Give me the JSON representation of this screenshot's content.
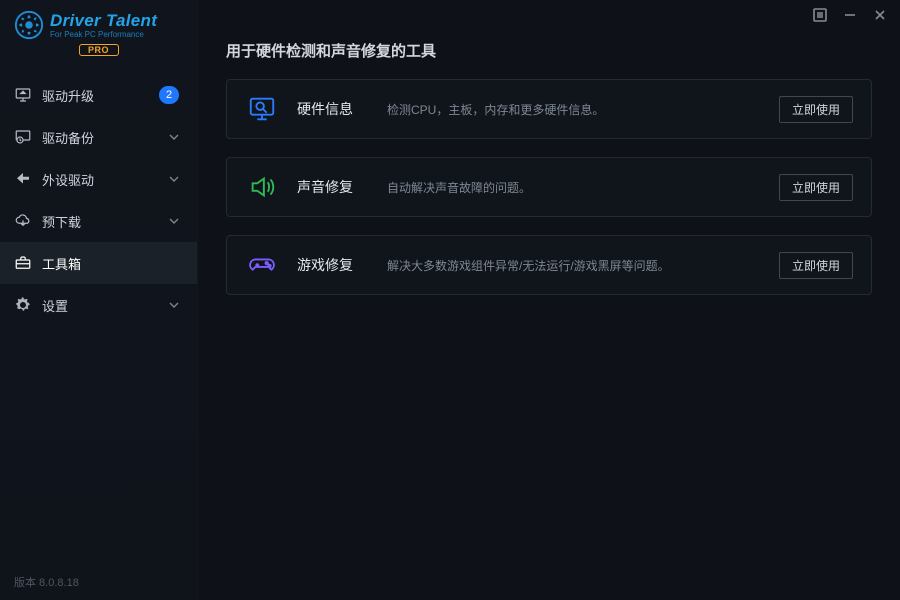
{
  "brand": {
    "title": "Driver Talent",
    "subtitle": "For Peak PC Performance",
    "pro": "PRO"
  },
  "sidebar": {
    "items": [
      {
        "label": "驱动升级",
        "icon": "monitor-upgrade-icon",
        "badge": "2",
        "caret": false
      },
      {
        "label": "驱动备份",
        "icon": "clock-backup-icon",
        "badge": null,
        "caret": true
      },
      {
        "label": "外设驱动",
        "icon": "peripheral-icon",
        "badge": null,
        "caret": true
      },
      {
        "label": "预下载",
        "icon": "cloud-download-icon",
        "badge": null,
        "caret": true
      },
      {
        "label": "工具箱",
        "icon": "toolbox-icon",
        "badge": null,
        "caret": false,
        "active": true
      },
      {
        "label": "设置",
        "icon": "gear-icon",
        "badge": null,
        "caret": true
      }
    ]
  },
  "page": {
    "title": "用于硬件检测和声音修复的工具"
  },
  "tools": [
    {
      "icon": "hardware-info-icon",
      "name": "硬件信息",
      "desc": "检测CPU，主板，内存和更多硬件信息。",
      "action": "立即使用",
      "accent": "#2a7bff"
    },
    {
      "icon": "speaker-fix-icon",
      "name": "声音修复",
      "desc": "自动解决声音故障的问题。",
      "action": "立即使用",
      "accent": "#2dbb55"
    },
    {
      "icon": "game-fix-icon",
      "name": "游戏修复",
      "desc": "解决大多数游戏组件异常/无法运行/游戏黑屏等问题。",
      "action": "立即使用",
      "accent": "#7b5cff"
    }
  ],
  "footer": {
    "version": "版本 8.0.8.18"
  },
  "titlebar": {
    "menu": "menu-icon",
    "minimize": "minimize-icon",
    "close": "close-icon"
  }
}
